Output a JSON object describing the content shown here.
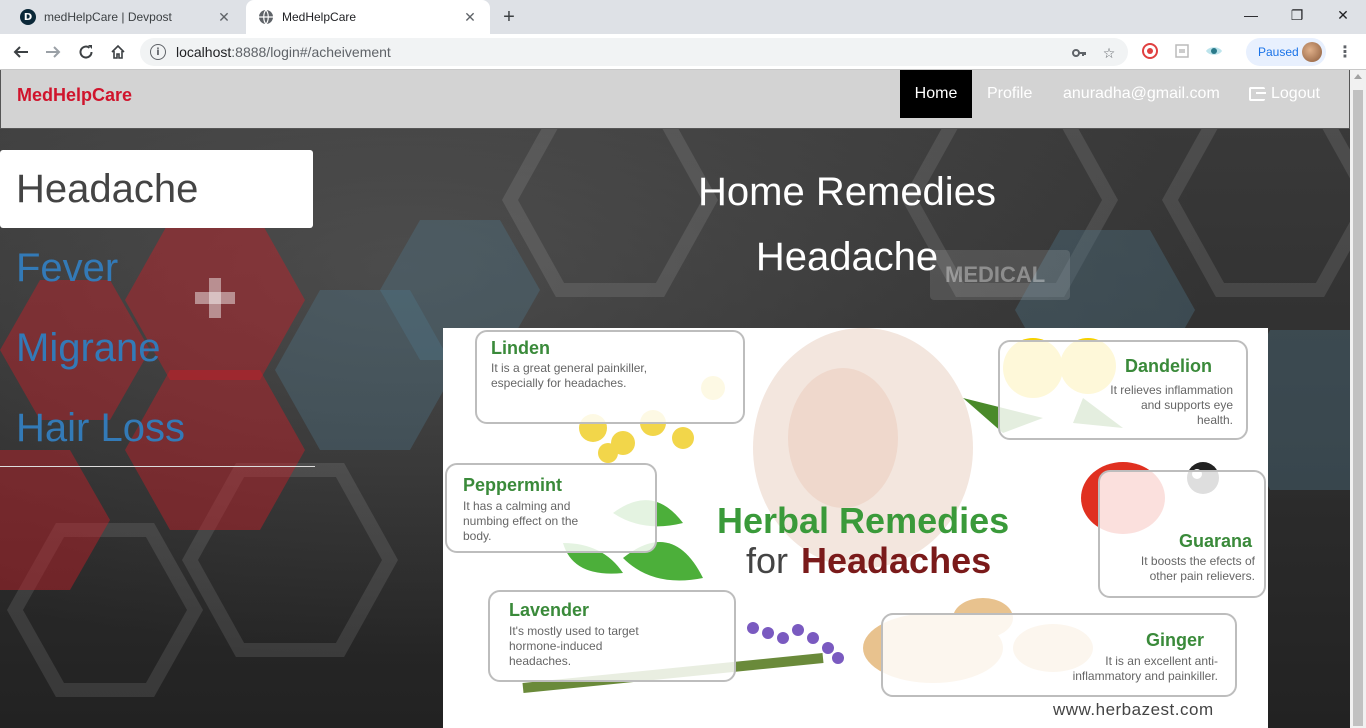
{
  "browser": {
    "tabs": [
      {
        "title": "medHelpCare | Devpost",
        "favicon": "devpost-icon",
        "active": false
      },
      {
        "title": "MedHelpCare",
        "favicon": "globe-icon",
        "active": true
      }
    ],
    "devpost_letter": "D",
    "url_host": "localhost",
    "url_rest": ":8888/login#/acheivement",
    "profile_status": "Paused"
  },
  "navbar": {
    "brand": "MedHelpCare",
    "brand_color": "#d0142c",
    "links": {
      "home": "Home",
      "profile": "Profile",
      "email": "anuradha@gmail.com",
      "logout": "Logout"
    }
  },
  "sidebar": {
    "items": [
      {
        "label": "Headache",
        "active": true
      },
      {
        "label": "Fever",
        "active": false
      },
      {
        "label": "Migrane",
        "active": false
      },
      {
        "label": "Hair Loss",
        "active": false
      }
    ]
  },
  "main": {
    "title": "Home Remedies",
    "subtitle": "Headache"
  },
  "poster": {
    "title_line1": "Herbal Remedies",
    "title_for": "for",
    "title_line2": "Headaches",
    "herbs": {
      "linden": {
        "name": "Linden",
        "desc": "It is a great general painkiller, especially for headaches."
      },
      "dandelion": {
        "name": "Dandelion",
        "desc": "It relieves inflammation and supports eye health."
      },
      "peppermint": {
        "name": "Peppermint",
        "desc": "It has a calming and numbing effect on the body."
      },
      "guarana": {
        "name": "Guarana",
        "desc": "It boosts the efects of other pain relievers."
      },
      "lavender": {
        "name": "Lavender",
        "desc": "It's mostly used to target hormone-induced headaches."
      },
      "ginger": {
        "name": "Ginger",
        "desc": "It is an excellent anti-inflammatory and painkiller."
      }
    },
    "website": "www.herbazest.com"
  }
}
